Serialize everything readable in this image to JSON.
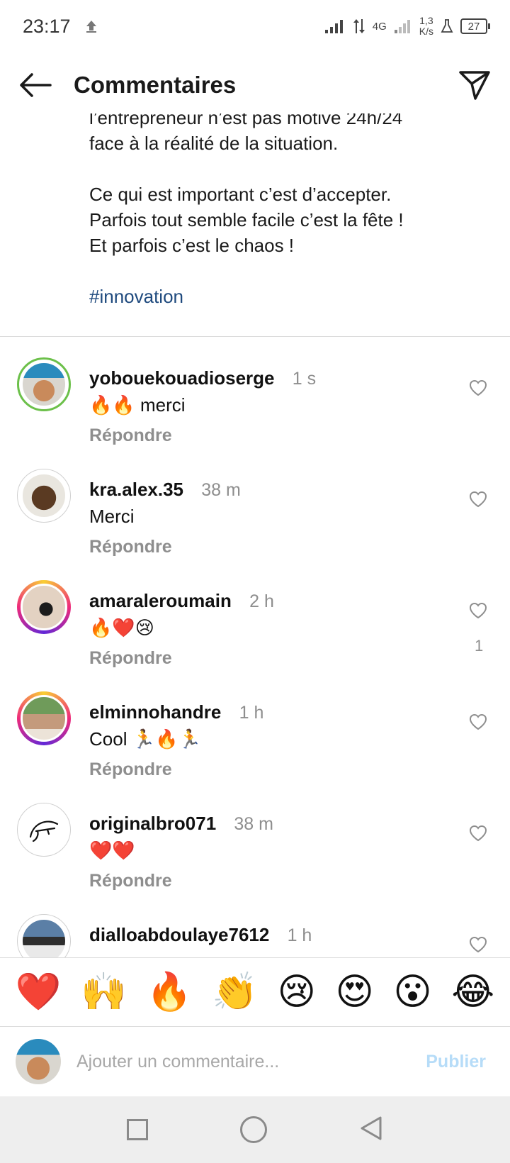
{
  "status_bar": {
    "time": "23:17",
    "network": "4G",
    "speed_value": "1,3",
    "speed_unit": "K/s",
    "battery": "27"
  },
  "header": {
    "title": "Commentaires",
    "back_icon": "arrow-left-icon",
    "share_icon": "paper-plane-icon"
  },
  "caption": {
    "line_top": "l’entrepreneur n’est pas motivé 24h/24\nface à la réalité de la situation.",
    "paragraph": "Ce qui est important c’est d’accepter.\nParfois tout semble facile c’est la fête !\nEt parfois c’est le chaos !",
    "hashtag": "#innovation"
  },
  "comments": [
    {
      "username": "yobouekouadioserge",
      "time": "1 s",
      "text": "🔥🔥 merci",
      "reply": "Répondre",
      "likes": ""
    },
    {
      "username": "kra.alex.35",
      "time": "38 m",
      "text": "Merci",
      "reply": "Répondre",
      "likes": ""
    },
    {
      "username": "amaraleroumain",
      "time": "2 h",
      "text": "🔥❤️😢",
      "reply": "Répondre",
      "likes": "1"
    },
    {
      "username": "elminnohandre",
      "time": "1 h",
      "text": "Cool 🏃🔥🏃",
      "reply": "Répondre",
      "likes": ""
    },
    {
      "username": "originalbro071",
      "time": "38 m",
      "text": "❤️❤️",
      "reply": "Répondre",
      "likes": ""
    },
    {
      "username": "dialloabdoulaye7612",
      "time": "1 h",
      "text": "",
      "reply": "",
      "likes": ""
    }
  ],
  "emoji_bar": [
    "❤️",
    "🙌",
    "🔥",
    "👏",
    "😢",
    "😍",
    "😮",
    "😂"
  ],
  "composer": {
    "placeholder": "Ajouter un commentaire...",
    "publish": "Publier"
  },
  "colors": {
    "link": "#1f4a7e",
    "muted": "#8e8e8e",
    "publish_disabled": "#b6dcf8",
    "story_ring_green": "#6cc04a"
  }
}
